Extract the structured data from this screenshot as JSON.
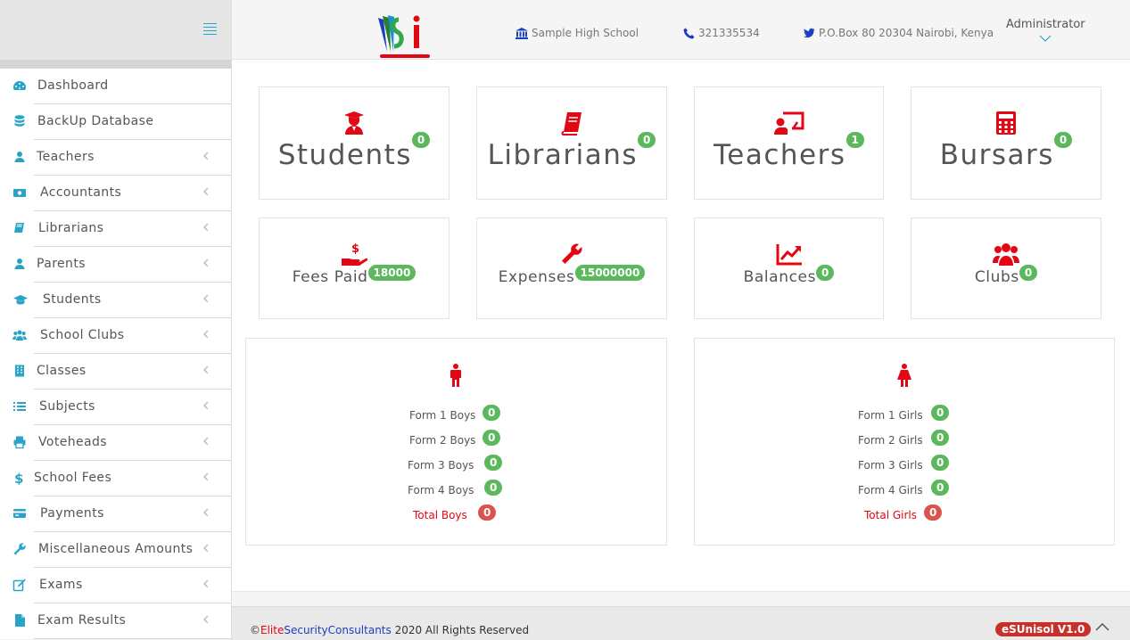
{
  "header": {
    "school": "Sample High School",
    "phone": "321335534",
    "address": "P.O.Box 80 20304 Nairobi, Kenya",
    "user": "Administrator"
  },
  "sidebar": {
    "items": [
      {
        "label": "Dashboard",
        "icon": "dashboard-icon"
      },
      {
        "label": "BackUp Database",
        "icon": "database-icon"
      },
      {
        "label": "Teachers",
        "icon": "user-icon"
      },
      {
        "label": "Accountants",
        "icon": "money-icon"
      },
      {
        "label": "Librarians",
        "icon": "book-icon"
      },
      {
        "label": "Parents",
        "icon": "user-icon"
      },
      {
        "label": "Students",
        "icon": "graduation-cap-icon"
      },
      {
        "label": "School Clubs",
        "icon": "users-icon"
      },
      {
        "label": "Classes",
        "icon": "building-icon"
      },
      {
        "label": "Subjects",
        "icon": "list-icon"
      },
      {
        "label": "Voteheads",
        "icon": "print-icon"
      },
      {
        "label": "School Fees",
        "icon": "dollar-icon"
      },
      {
        "label": "Payments",
        "icon": "credit-card-icon"
      },
      {
        "label": "Miscellaneous Amounts",
        "icon": "wrench-icon"
      },
      {
        "label": "Exams",
        "icon": "edit-icon"
      },
      {
        "label": "Exam Results",
        "icon": "file-icon"
      }
    ]
  },
  "stats_top": [
    {
      "label": "Students",
      "count": "0",
      "icon": "user-graduate-icon"
    },
    {
      "label": "Librarians",
      "count": "0",
      "icon": "book-icon"
    },
    {
      "label": "Teachers",
      "count": "1",
      "icon": "chalkboard-teacher-icon"
    },
    {
      "label": "Bursars",
      "count": "0",
      "icon": "calculator-icon"
    }
  ],
  "stats_bottom": [
    {
      "label": "Fees Paid",
      "count": "18000",
      "icon": "hand-dollar-icon"
    },
    {
      "label": "Expenses",
      "count": "15000000",
      "icon": "wrench-icon"
    },
    {
      "label": "Balances",
      "count": "0",
      "icon": "line-chart-icon"
    },
    {
      "label": "Clubs",
      "count": "0",
      "icon": "users-icon"
    }
  ],
  "boys": {
    "rows": [
      {
        "label": "Form 1 Boys",
        "count": "0"
      },
      {
        "label": "Form 2 Boys",
        "count": "0"
      },
      {
        "label": "Form 3 Boys",
        "count": "0"
      },
      {
        "label": "Form 4 Boys",
        "count": "0"
      }
    ],
    "total_label": "Total Boys",
    "total": "0"
  },
  "girls": {
    "rows": [
      {
        "label": "Form 1 Girls",
        "count": "0"
      },
      {
        "label": "Form 2 Girls",
        "count": "0"
      },
      {
        "label": "Form 3 Girls",
        "count": "0"
      },
      {
        "label": "Form 4 Girls",
        "count": "0"
      }
    ],
    "total_label": "Total Girls",
    "total": "0"
  },
  "footer": {
    "copy_symbol": "©",
    "brand_1": "Elite",
    "brand_2": "SecurityConsultants",
    "rest": " 2020 All Rights Reserved",
    "version": "eSUnisol V1.0"
  },
  "colors": {
    "accent": "#2aa3c9",
    "icon_red": "#e30613",
    "badge_green": "#5cb85c",
    "badge_red": "#d9534f"
  }
}
